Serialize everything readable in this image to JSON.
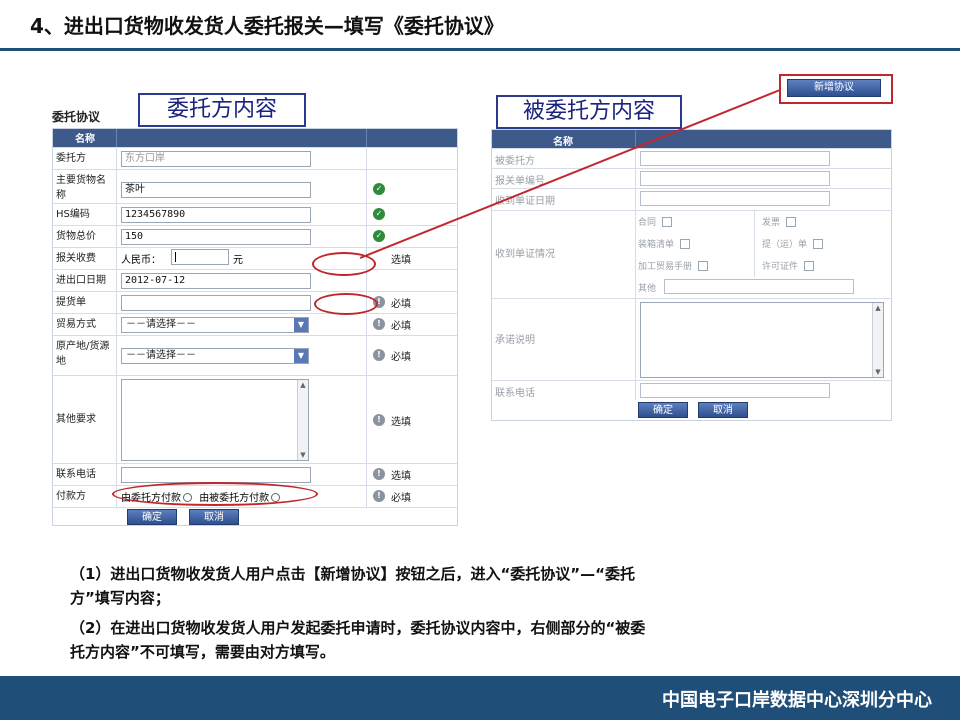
{
  "slide": {
    "title": "4、进出口货物收发货人委托报关—填写《委托协议》",
    "footer": "中国电子口岸数据中心深圳分中心"
  },
  "colors": {
    "accent": "#1f4e79",
    "highlight": "#c0272d",
    "header": "#3d5a8a"
  },
  "left_form": {
    "caption": "委托协议",
    "big_label": "委托方内容",
    "header": "名称",
    "rows": {
      "consignor": {
        "label": "委托方",
        "value": "东方口岸"
      },
      "goods": {
        "label": "主要货物名称",
        "value": "茶叶",
        "status_icon": "check-icon"
      },
      "hs": {
        "label": "HS编码",
        "value": "1234567890",
        "status_icon": "check-icon"
      },
      "total": {
        "label": "货物总价",
        "value": "150",
        "status_icon": "check-icon"
      },
      "fee": {
        "label": "报关收费",
        "currency": "人民币：",
        "unit": "元",
        "status": "选填"
      },
      "date": {
        "label": "进出口日期",
        "value": "2012-07-12"
      },
      "bill": {
        "label": "提货单",
        "status": "必填"
      },
      "trade": {
        "label": "贸易方式",
        "value": "－－请选择－－",
        "status": "必填"
      },
      "origin": {
        "label": "原产地/货源地",
        "value": "－－请选择－－",
        "status": "必填"
      },
      "other": {
        "label": "其他要求",
        "status": "选填"
      },
      "phone": {
        "label": "联系电话",
        "status": "选填"
      },
      "payment": {
        "label": "付款方",
        "option1": "由委托方付款",
        "option2": "由被委托方付款",
        "status": "必填"
      }
    },
    "buttons": {
      "ok": "确定",
      "cancel": "取消"
    }
  },
  "right_form": {
    "big_label": "被委托方内容",
    "header": "名称",
    "add_button": "新增协议",
    "rows": {
      "agent": "被委托方",
      "declaration_no": "报关单编号",
      "receipt_date": "收到单证日期",
      "documents": "收到单证情况",
      "commitment": "承诺说明",
      "phone": "联系电话"
    },
    "documents": {
      "contract": "合同",
      "invoice": "发票",
      "packing": "装箱清单",
      "bol": "提（运）单",
      "handbook": "加工贸易手册",
      "license": "许可证件",
      "other": "其他"
    },
    "buttons": {
      "ok": "确定",
      "cancel": "取消"
    }
  },
  "description": {
    "line1": "（1）进出口货物收发货人用户点击【新增协议】按钮之后，进入“委托协议”—“委托",
    "line2": "方”填写内容；",
    "line3": "（2）在进出口货物收发货人用户发起委托申请时，委托协议内容中，右侧部分的“被委",
    "line4": "托方内容”不可填写，需要由对方填写。"
  }
}
